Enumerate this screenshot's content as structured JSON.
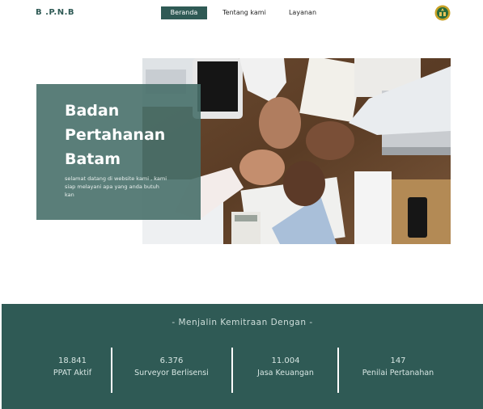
{
  "header": {
    "brand": "B .P.N.B",
    "nav": [
      {
        "label": "Beranda"
      },
      {
        "label": "Tentang kami"
      },
      {
        "label": "Layanan"
      }
    ]
  },
  "hero": {
    "title_lines": [
      "Badan",
      "Pertahanan",
      "Batam"
    ],
    "subtitle": "selamat datang di website kami , kami siap melayani apa yang anda butuh kan"
  },
  "partners": {
    "heading": "- Menjalin Kemitraan Dengan -",
    "stats": [
      {
        "value": "18.841",
        "label": "PPAT Aktif"
      },
      {
        "value": "6.376",
        "label": "Surveyor Berlisensi"
      },
      {
        "value": "11.004",
        "label": "Jasa Keuangan"
      },
      {
        "value": "147",
        "label": "Penilai Pertanahan"
      }
    ]
  },
  "colors": {
    "primary": "#2f5a55",
    "hero_overlay": "#48706a",
    "text_light": "#ffffff"
  },
  "icons": {
    "logo": "government-seal-icon"
  }
}
